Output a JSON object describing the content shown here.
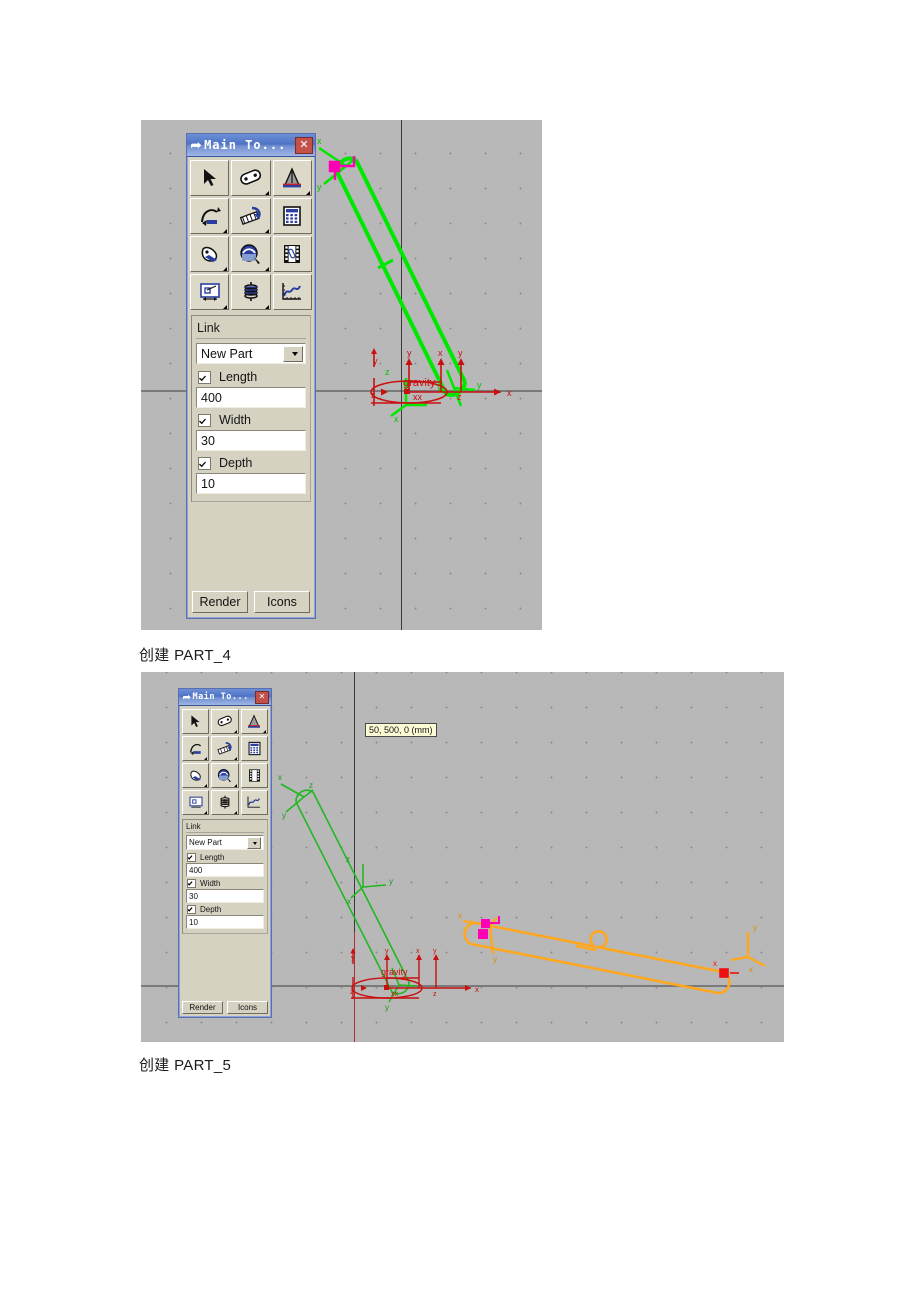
{
  "document": {
    "captions": [
      {
        "id": "cap1",
        "text": "创建 PART_4"
      },
      {
        "id": "cap2",
        "text": "创建 PART_5"
      }
    ]
  },
  "palette": {
    "title": "Main To...",
    "title_icon": "wrench-icon",
    "close_label": "✕",
    "tools": [
      {
        "name": "select-arrow-tool",
        "label": "Select"
      },
      {
        "name": "rigid-body-link-tool",
        "label": "Rigid Body: Link"
      },
      {
        "name": "measure-compass-tool",
        "label": "Measure"
      },
      {
        "name": "motion-joint-tool",
        "label": "Joint"
      },
      {
        "name": "constraint-tool",
        "label": "Constraints"
      },
      {
        "name": "calculator-tool",
        "label": "Calculator"
      },
      {
        "name": "force-contact-tool",
        "label": "Forces"
      },
      {
        "name": "simulation-tool",
        "label": "Simulation"
      },
      {
        "name": "animation-film-tool",
        "label": "Animation"
      },
      {
        "name": "measure-display-tool",
        "label": "Measures"
      },
      {
        "name": "spring-damper-tool",
        "label": "Spring Damper"
      },
      {
        "name": "plot-postprocess-tool",
        "label": "Plotting"
      }
    ],
    "section_label": "Link",
    "part_select": {
      "value": "New Part",
      "options": [
        "New Part"
      ]
    },
    "fields": [
      {
        "name": "length",
        "checkbox_label": "Length",
        "checked": true,
        "value": "400"
      },
      {
        "name": "width",
        "checkbox_label": "Width",
        "checked": true,
        "value": "30"
      },
      {
        "name": "depth",
        "checkbox_label": "Depth",
        "checked": true,
        "value": "10"
      }
    ],
    "buttons": [
      {
        "name": "render-button",
        "label": "Render"
      },
      {
        "name": "icons-button",
        "label": "Icons"
      }
    ]
  },
  "viewport1": {
    "name": "adams-viewport-part4",
    "background": "#b8b8b8",
    "gravity_label": "gravity",
    "axis_labels": {
      "x": "x",
      "y": "y",
      "z": "z"
    },
    "selected_link_color": "#00e800",
    "marker_color": "#ff00b4",
    "origin_color": "#c81010"
  },
  "viewport2": {
    "name": "adams-viewport-part5",
    "background": "#b8b8b8",
    "gravity_label": "gravity",
    "coordinate_tooltip": "50, 500, 0 (mm)",
    "axis_labels": {
      "x": "x",
      "y": "y",
      "z": "z"
    },
    "link1_color": "#23b723",
    "link2_color": "#ffa81e",
    "marker_colors": {
      "magenta": "#ff00b4",
      "red": "#ee1111",
      "blue": "#1414cc",
      "green": "#11dd11"
    }
  }
}
